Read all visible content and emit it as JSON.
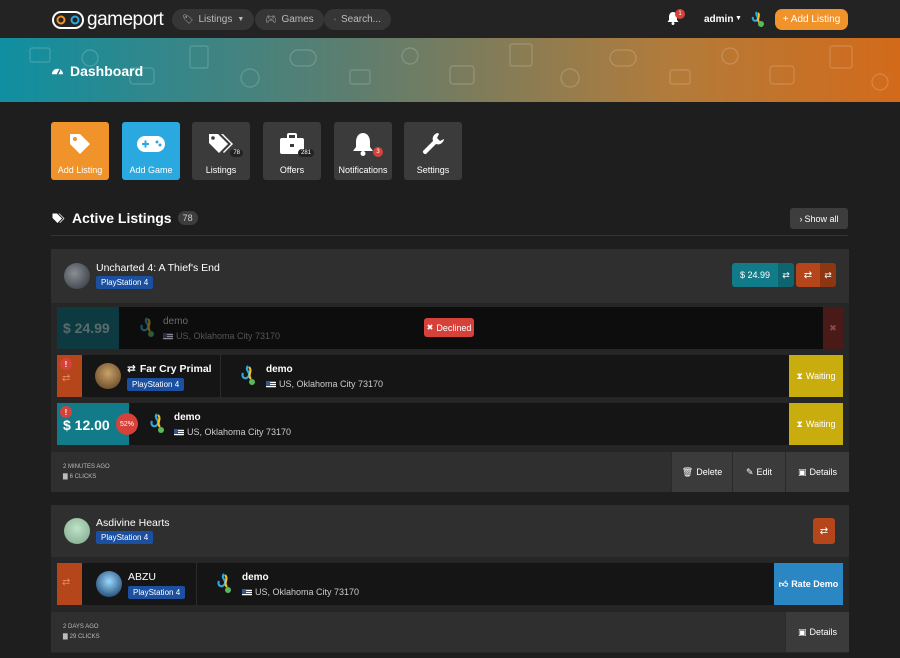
{
  "nav": {
    "brand": "gameport",
    "listings_label": "Listings",
    "games_label": "Games",
    "search_placeholder": "Search...",
    "notification_count": "1",
    "user_name": "admin",
    "add_listing_label": "+ Add Listing"
  },
  "banner": {
    "title": "Dashboard"
  },
  "tiles": [
    {
      "label": "Add Listing",
      "icon": "tag-icon",
      "color": "#f0932b"
    },
    {
      "label": "Add Game",
      "icon": "gamepad-icon",
      "color": "#2aa9e0"
    },
    {
      "label": "Listings",
      "icon": "tags-icon",
      "count": "78"
    },
    {
      "label": "Offers",
      "icon": "briefcase-icon",
      "count": "281"
    },
    {
      "label": "Notifications",
      "icon": "bell-icon",
      "count": "3"
    },
    {
      "label": "Settings",
      "icon": "wrench-icon"
    }
  ],
  "active_listings": {
    "title": "Active Listings",
    "count": "78",
    "show_all": "Show all"
  },
  "listings": [
    {
      "game": "Uncharted 4: A Thief's End",
      "platform": "PlayStation 4",
      "price_badge": "$ 24.99",
      "offers": [
        {
          "price": "$ 24.99",
          "user": "demo",
          "location": "US, Oklahoma City 73170",
          "status": "Declined"
        },
        {
          "trade_game": "Far Cry Primal",
          "platform": "PlayStation 4",
          "user": "demo",
          "location": "US, Oklahoma City 73170",
          "status": "Waiting"
        },
        {
          "price": "$ 12.00",
          "discount": "52%",
          "user": "demo",
          "location": "US, Oklahoma City 73170",
          "status": "Waiting"
        }
      ],
      "time_ago": "2 MINUTES AGO",
      "clicks": "6 CLICKS",
      "delete_label": "Delete",
      "edit_label": "Edit",
      "details_label": "Details"
    },
    {
      "game": "Asdivine Hearts",
      "platform": "PlayStation 4",
      "offers": [
        {
          "trade_game": "ABZU",
          "platform": "PlayStation 4",
          "user": "demo",
          "location": "US, Oklahoma City 73170",
          "action": "Rate Demo"
        }
      ],
      "time_ago": "2 DAYS AGO",
      "clicks": "29 CLICKS",
      "details_label": "Details"
    }
  ],
  "colors": {
    "orange": "#f0932b",
    "blue": "#2aa9e0",
    "teal": "#127b8a",
    "rust": "#b5451b",
    "waiting": "#c9ad0f",
    "declined": "#d6413a",
    "platform": "#1b4fa0"
  }
}
